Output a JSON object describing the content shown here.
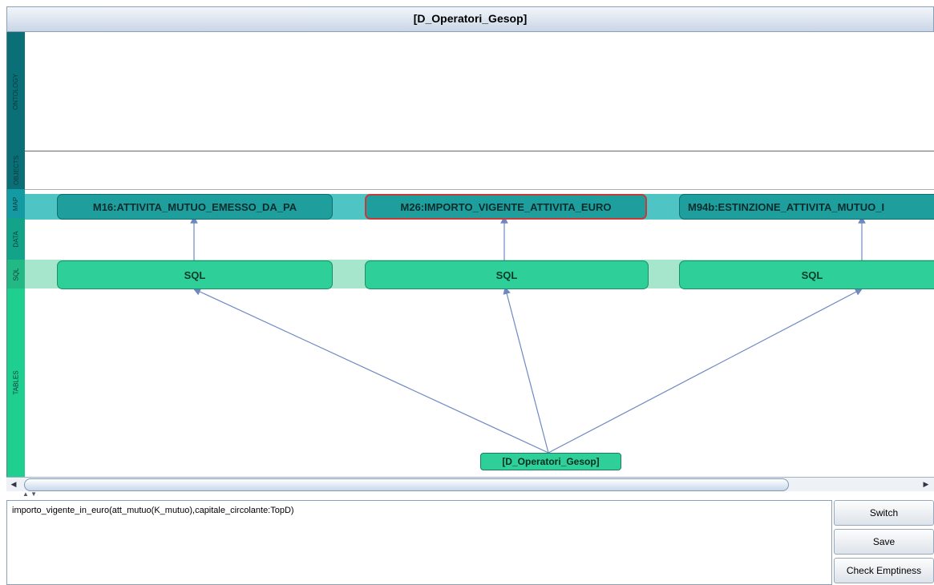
{
  "window": {
    "title": "[D_Operatori_Gesop]"
  },
  "lanes": [
    {
      "id": "ontology",
      "label": "ONTOLOGY"
    },
    {
      "id": "objects",
      "label": "OBJECTS"
    },
    {
      "id": "map",
      "label": "MAP"
    },
    {
      "id": "data",
      "label": "DATA"
    },
    {
      "id": "sql",
      "label": "SQL"
    },
    {
      "id": "tables",
      "label": "TABLES"
    }
  ],
  "map_nodes": [
    {
      "label": "M16:ATTIVITA_MUTUO_EMESSO_DA_PA",
      "selected": false
    },
    {
      "label": "M26:IMPORTO_VIGENTE_ATTIVITA_EURO",
      "selected": true
    },
    {
      "label": "M94b:ESTINZIONE_ATTIVITA_MUTUO_I",
      "selected": false
    }
  ],
  "sql_nodes": [
    {
      "label": "SQL"
    },
    {
      "label": "SQL"
    },
    {
      "label": "SQL"
    }
  ],
  "table_node": {
    "label": "[D_Operatori_Gesop]"
  },
  "query": {
    "text": "importo_vigente_in_euro(att_mutuo(K_mutuo),capitale_circolante:TopD)"
  },
  "buttons": {
    "switch": "Switch",
    "save": "Save",
    "check": "Check Emptiness"
  },
  "colors": {
    "lane_ontology": "#0b6f78",
    "lane_objects": "#0b6f78",
    "lane_map": "#149aa2",
    "lane_data": "#12a389",
    "lane_sql": "#22b985",
    "lane_tables": "#1fcf8f",
    "map_band": "#4fc4c4",
    "sql_band": "#a5e6cc",
    "arrow": "#6f88c2"
  }
}
